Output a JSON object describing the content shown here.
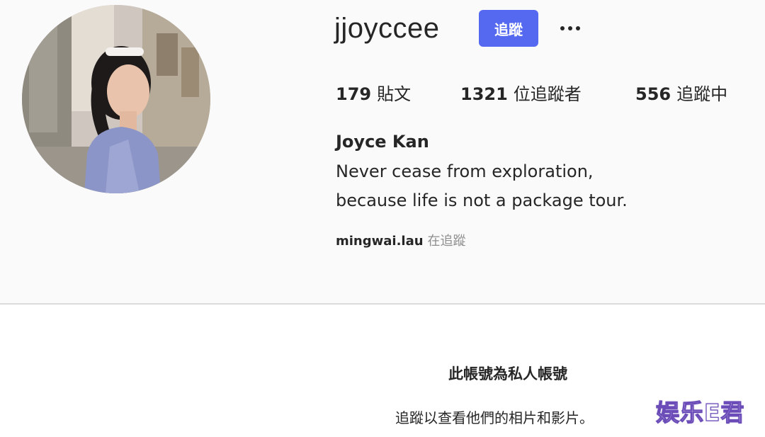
{
  "profile": {
    "username": "jjoyccee",
    "follow_label": "追蹤",
    "more_label": "more options",
    "stats": [
      {
        "count": "179",
        "label": "貼文"
      },
      {
        "count": "1321",
        "label": "位追蹤者"
      },
      {
        "count": "556",
        "label": "追蹤中"
      }
    ],
    "full_name": "Joyce Kan",
    "bio_lines": [
      "Never cease from exploration,",
      "because life is not a package tour."
    ],
    "followed_by_user": "mingwai.lau",
    "followed_by_suffix": "在追蹤"
  },
  "private_notice": {
    "title": "此帳號為私人帳號",
    "description": "追蹤以查看他們的相片和影片。"
  },
  "watermark": {
    "text": "娱乐E君"
  },
  "colors": {
    "follow_button": "#5468f0",
    "page_background": "#fafafa",
    "divider": "#dbdbdb",
    "secondary_text": "#8e8e8e"
  },
  "icons": {
    "more": "more-options-icon"
  }
}
